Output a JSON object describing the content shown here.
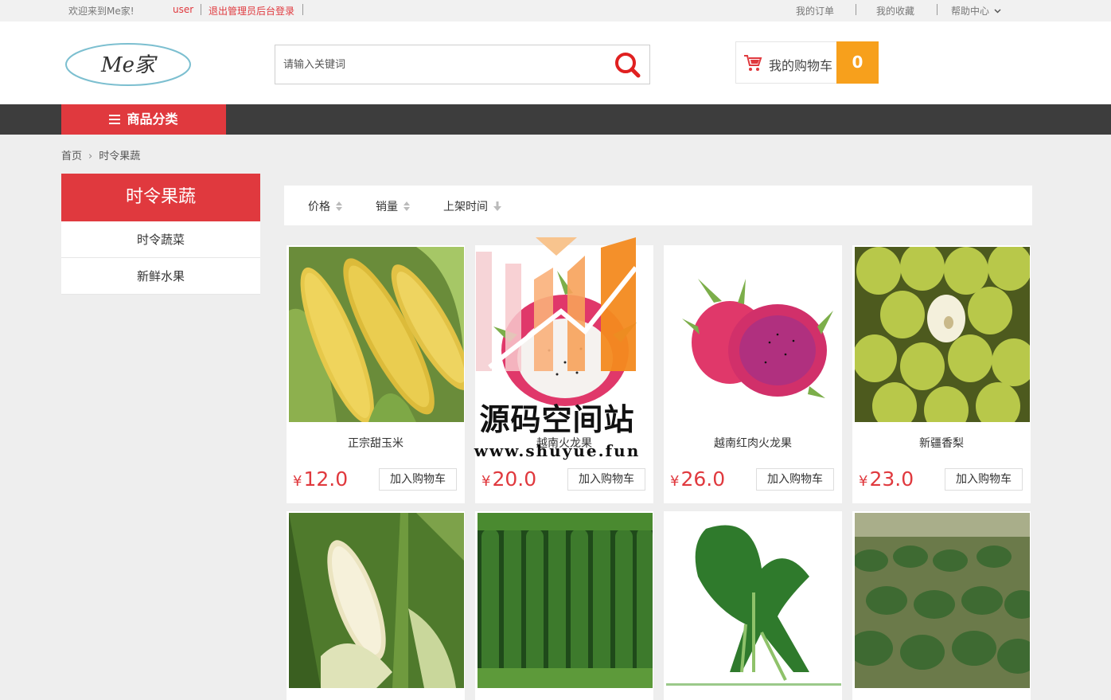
{
  "topbar": {
    "welcome": "欢迎来到Me家!",
    "user": "user",
    "logout": "退出管理员后台登录",
    "orders": "我的订单",
    "favorites": "我的收藏",
    "help": "帮助中心"
  },
  "header": {
    "logo_text": "Me家",
    "search_placeholder": "请输入关键词",
    "search_value": "",
    "cart_label": "我的购物车",
    "cart_count": "0"
  },
  "nav": {
    "category_label": "商品分类"
  },
  "breadcrumb": {
    "home": "首页",
    "current": "时令果蔬"
  },
  "sidebar": {
    "title": "时令果蔬",
    "items": [
      "时令蔬菜",
      "新鲜水果"
    ]
  },
  "sort": {
    "price": "价格",
    "sales": "销量",
    "time": "上架时间"
  },
  "products": [
    {
      "name": "正宗甜玉米",
      "currency": "¥",
      "price": "12.0",
      "button": "加入购物车",
      "image": "corn"
    },
    {
      "name": "越南火龙果",
      "currency": "¥",
      "price": "20.0",
      "button": "加入购物车",
      "image": "dragonfruit"
    },
    {
      "name": "越南红肉火龙果",
      "currency": "¥",
      "price": "26.0",
      "button": "加入购物车",
      "image": "red-dragonfruit"
    },
    {
      "name": "新疆香梨",
      "currency": "¥",
      "price": "23.0",
      "button": "加入购物车",
      "image": "pears"
    },
    {
      "image": "white-corn"
    },
    {
      "image": "cucumbers"
    },
    {
      "image": "choy-sum"
    },
    {
      "image": "vegetable-field"
    }
  ],
  "watermark": {
    "title": "源码空间站",
    "url": "www.shuyue.fun"
  },
  "colors": {
    "accent": "#e0393e",
    "cart_badge": "#f7a01c",
    "nav_bg": "#3d3d3d",
    "page_bg": "#eeeeee"
  }
}
